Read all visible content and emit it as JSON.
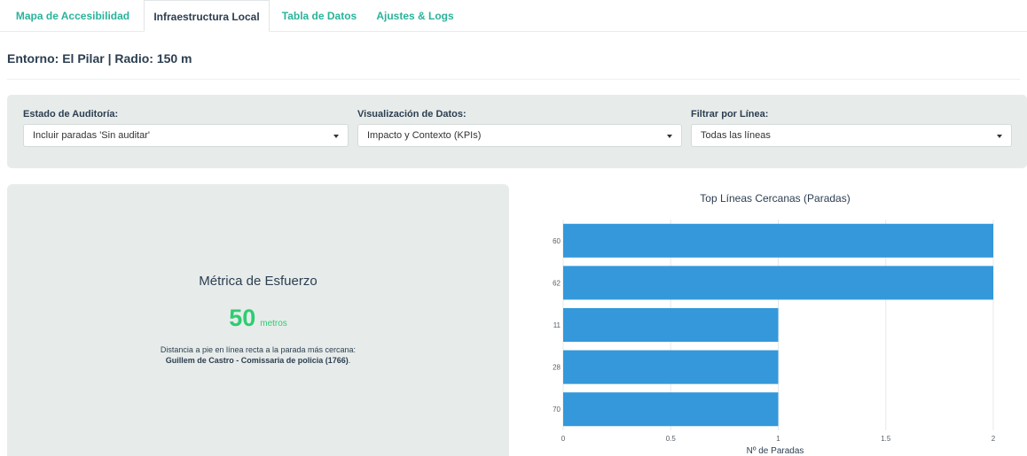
{
  "tabs": [
    {
      "label": "Mapa de Accesibilidad",
      "active": false
    },
    {
      "label": "Infraestructura Local",
      "active": true
    },
    {
      "label": "Tabla de Datos",
      "active": false
    },
    {
      "label": "Ajustes & Logs",
      "active": false
    }
  ],
  "header": {
    "entorno": "Entorno: El Pilar | Radio: 150 m"
  },
  "filters": {
    "audit": {
      "label": "Estado de Auditoría:",
      "value": "Incluir paradas 'Sin auditar'"
    },
    "visualization": {
      "label": "Visualización de Datos:",
      "value": "Impacto y Contexto (KPIs)"
    },
    "line": {
      "label": "Filtrar por Línea:",
      "value": "Todas las líneas"
    }
  },
  "metric": {
    "title": "Métrica de Esfuerzo",
    "value": "50",
    "unit": "metros",
    "description": "Distancia a pie en línea recta a la parada más cercana:",
    "stop_name": "Guillem de Castro - Comissaria de policia (1766)",
    "stop_suffix": "."
  },
  "chart_data": {
    "type": "bar",
    "orientation": "horizontal",
    "title": "Top Líneas Cercanas (Paradas)",
    "xlabel": "Nº de Paradas",
    "ylabel": "",
    "categories": [
      "60",
      "62",
      "11",
      "28",
      "70"
    ],
    "values": [
      2,
      2,
      1,
      1,
      1
    ],
    "xlim": [
      0,
      2
    ],
    "xticks": [
      "0",
      "0.5",
      "1",
      "1.5",
      "2"
    ],
    "bar_color": "#3498db",
    "grid": true
  },
  "colors": {
    "accent": "#2bb39a",
    "metric_green": "#2ecc71",
    "panel_bg": "#e7ecea",
    "bar": "#3498db"
  },
  "icons": {
    "select_caret": "caret-down-icon"
  }
}
